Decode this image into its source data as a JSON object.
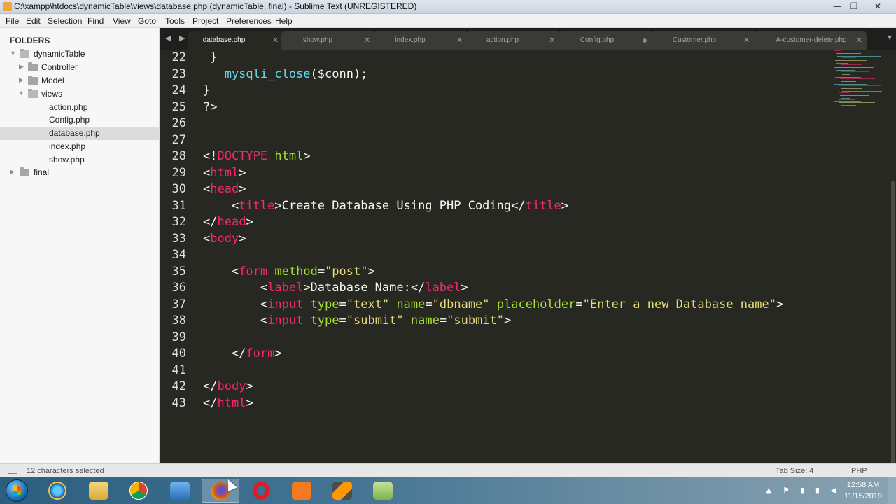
{
  "window": {
    "title": "C:\\xampp\\htdocs\\dynamicTable\\views\\database.php (dynamicTable, final) - Sublime Text (UNREGISTERED)",
    "minimize": "—",
    "maximize": "❐",
    "close": "✕"
  },
  "menu": [
    "File",
    "Edit",
    "Selection",
    "Find",
    "View",
    "Goto",
    "Tools",
    "Project",
    "Preferences",
    "Help"
  ],
  "sidebar": {
    "header": "FOLDERS",
    "items": [
      {
        "label": "dynamicTable",
        "type": "folder-open",
        "level": 0
      },
      {
        "label": "Controller",
        "type": "folder",
        "level": 1
      },
      {
        "label": "Model",
        "type": "folder",
        "level": 1
      },
      {
        "label": "views",
        "type": "folder-open",
        "level": 1
      },
      {
        "label": "action.php",
        "type": "file",
        "level": 2
      },
      {
        "label": "Config.php",
        "type": "file",
        "level": 2
      },
      {
        "label": "database.php",
        "type": "file",
        "level": 2,
        "selected": true
      },
      {
        "label": "index.php",
        "type": "file",
        "level": 2
      },
      {
        "label": "show.php",
        "type": "file",
        "level": 2
      },
      {
        "label": "final",
        "type": "folder",
        "level": 0
      }
    ]
  },
  "tabs": [
    {
      "label": "database.php",
      "active": true,
      "modified": false
    },
    {
      "label": "show.php",
      "active": false,
      "modified": false
    },
    {
      "label": "index.php",
      "active": false,
      "modified": false
    },
    {
      "label": "action.php",
      "active": false,
      "modified": false
    },
    {
      "label": "Config.php",
      "active": false,
      "modified": true
    },
    {
      "label": "Customer.php",
      "active": false,
      "modified": false
    },
    {
      "label": "A-customer-delete.php",
      "active": false,
      "modified": false
    }
  ],
  "editor": {
    "lines": [
      {
        "n": "22",
        "tokens": [
          [
            "txt",
            " }"
          ]
        ]
      },
      {
        "n": "23",
        "tokens": [
          [
            "fn",
            "   mysqli_close"
          ],
          [
            "txt",
            "($conn);"
          ]
        ]
      },
      {
        "n": "24",
        "tokens": [
          [
            "txt",
            "}"
          ]
        ]
      },
      {
        "n": "25",
        "tokens": [
          [
            "txt",
            "?>"
          ]
        ]
      },
      {
        "n": "26",
        "tokens": []
      },
      {
        "n": "27",
        "tokens": []
      },
      {
        "n": "28",
        "tokens": [
          [
            "txt",
            "<!"
          ],
          [
            "tag",
            "DOCTYPE"
          ],
          [
            "txt",
            " "
          ],
          [
            "attr",
            "html"
          ],
          [
            "txt",
            ">"
          ]
        ]
      },
      {
        "n": "29",
        "tokens": [
          [
            "txt",
            "<"
          ],
          [
            "tag",
            "html"
          ],
          [
            "txt",
            ">"
          ]
        ]
      },
      {
        "n": "30",
        "tokens": [
          [
            "txt",
            "<"
          ],
          [
            "tag",
            "head"
          ],
          [
            "txt",
            ">"
          ]
        ]
      },
      {
        "n": "31",
        "tokens": [
          [
            "txt",
            "    <"
          ],
          [
            "tag",
            "title"
          ],
          [
            "txt",
            ">Create Database Using PHP Coding</"
          ],
          [
            "tag",
            "title"
          ],
          [
            "txt",
            ">"
          ]
        ]
      },
      {
        "n": "32",
        "tokens": [
          [
            "txt",
            "</"
          ],
          [
            "tag",
            "head"
          ],
          [
            "txt",
            ">"
          ]
        ]
      },
      {
        "n": "33",
        "tokens": [
          [
            "txt",
            "<"
          ],
          [
            "tag",
            "body"
          ],
          [
            "txt",
            ">"
          ]
        ]
      },
      {
        "n": "34",
        "tokens": []
      },
      {
        "n": "35",
        "tokens": [
          [
            "txt",
            "    <"
          ],
          [
            "tag",
            "form"
          ],
          [
            "txt",
            " "
          ],
          [
            "attr",
            "method"
          ],
          [
            "txt",
            "="
          ],
          [
            "str",
            "\"post\""
          ],
          [
            "txt",
            ">"
          ]
        ]
      },
      {
        "n": "36",
        "tokens": [
          [
            "txt",
            "        <"
          ],
          [
            "tag",
            "label"
          ],
          [
            "txt",
            ">Database Name:</"
          ],
          [
            "tag",
            "label"
          ],
          [
            "txt",
            ">"
          ]
        ]
      },
      {
        "n": "37",
        "tokens": [
          [
            "txt",
            "        <"
          ],
          [
            "tag",
            "input"
          ],
          [
            "txt",
            " "
          ],
          [
            "attr",
            "type"
          ],
          [
            "txt",
            "="
          ],
          [
            "str",
            "\"text\""
          ],
          [
            "txt",
            " "
          ],
          [
            "attr",
            "name"
          ],
          [
            "txt",
            "="
          ],
          [
            "str",
            "\"dbname\""
          ],
          [
            "txt",
            " "
          ],
          [
            "attr",
            "placeholder"
          ],
          [
            "txt",
            "="
          ],
          [
            "str",
            "\"Enter a new Database name\""
          ],
          [
            "txt",
            ">"
          ]
        ]
      },
      {
        "n": "38",
        "tokens": [
          [
            "txt",
            "        <"
          ],
          [
            "tag",
            "input"
          ],
          [
            "txt",
            " "
          ],
          [
            "attr",
            "type"
          ],
          [
            "txt",
            "="
          ],
          [
            "str",
            "\"submit\""
          ],
          [
            "txt",
            " "
          ],
          [
            "attr",
            "name"
          ],
          [
            "txt",
            "="
          ],
          [
            "str",
            "\"submit\""
          ],
          [
            "txt",
            ">"
          ]
        ]
      },
      {
        "n": "39",
        "tokens": []
      },
      {
        "n": "40",
        "tokens": [
          [
            "txt",
            "    </"
          ],
          [
            "tag",
            "form"
          ],
          [
            "txt",
            ">"
          ]
        ]
      },
      {
        "n": "41",
        "tokens": []
      },
      {
        "n": "42",
        "tokens": [
          [
            "txt",
            "</"
          ],
          [
            "tag",
            "body"
          ],
          [
            "txt",
            ">"
          ]
        ]
      },
      {
        "n": "43",
        "tokens": [
          [
            "txt",
            "</"
          ],
          [
            "tag",
            "html"
          ],
          [
            "txt",
            ">"
          ]
        ]
      }
    ]
  },
  "status": {
    "selection": "12 characters selected",
    "tab_size": "Tab Size: 4",
    "syntax": "PHP"
  },
  "taskbar": {
    "apps": [
      "internet-explorer",
      "file-explorer",
      "chrome",
      "media-player",
      "firefox",
      "opera",
      "xampp",
      "sublime-text",
      "notepad"
    ],
    "active_app": "firefox",
    "time": "12:58 AM",
    "date": "11/15/2019"
  },
  "colors": {
    "editor_bg": "#272822",
    "tag": "#f92672",
    "attr": "#a6e22e",
    "string": "#e6db74",
    "function": "#66d9ef"
  }
}
